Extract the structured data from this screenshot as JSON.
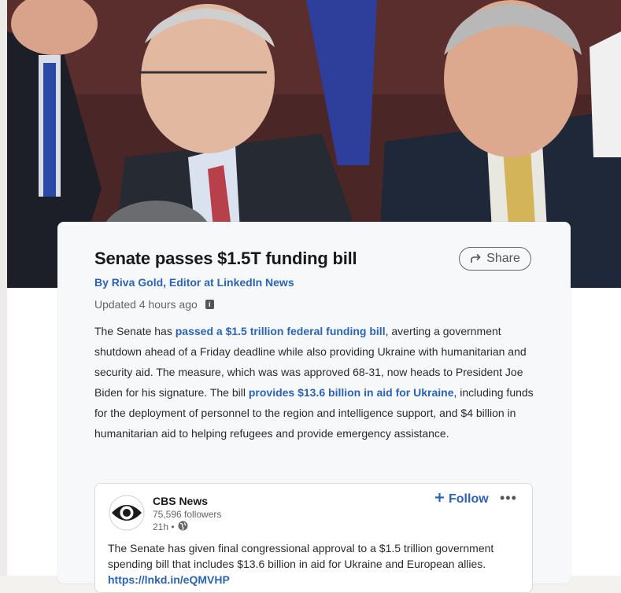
{
  "article": {
    "title": "Senate passes $1.5T funding bill",
    "byline": "By Riva Gold, Editor at LinkedIn News",
    "updated": "Updated 4 hours ago",
    "share_label": "Share",
    "body": {
      "p1": "The Senate has ",
      "link1": "passed a $1.5 trillion federal funding bill",
      "p2": ", averting a government shutdown ahead of a Friday deadline while also providing Ukraine with humanitarian and security aid. The measure, which was was approved 68-31, now heads to President Joe Biden for his signature. The bill ",
      "link2": "provides $13.6 billion in aid for Ukraine",
      "p3": ", including funds for the deployment of personnel to the region and intelligence support, and $4 billion in humanitarian aid to helping refugees and provide emergency assistance."
    }
  },
  "embedded_post": {
    "org_name": "CBS News",
    "followers": "75,596 followers",
    "time": "21h •",
    "follow_label": "Follow",
    "more_label": "•••",
    "text": "The Senate has given final congressional approval to a $1.5 trillion government spending bill that includes $13.6 billion in aid for Ukraine and European allies.",
    "link_fragment": "https://lnkd.in/eQMVHP"
  },
  "icons": {
    "share": "share-arrow-icon",
    "info": "info-icon",
    "globe": "globe-icon",
    "plus": "plus-icon",
    "logo": "cbs-eye-logo"
  },
  "colors": {
    "link_blue": "#2a64b8",
    "card_bg": "#f7f8f9",
    "page_bg": "#f3f2ef"
  }
}
